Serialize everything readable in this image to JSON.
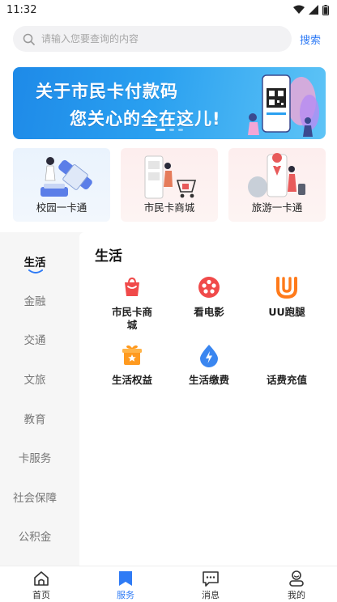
{
  "status_bar": {
    "time": "11:32",
    "icons": [
      "wifi-icon",
      "signal-icon",
      "battery-icon"
    ]
  },
  "search": {
    "placeholder": "请输入您要查询的内容",
    "button_label": "搜索"
  },
  "banner": {
    "line1": "关于市民卡付款码",
    "line2": "您关心的全在这儿!",
    "slide_count": 3,
    "active_slide": 1
  },
  "quick_cards": [
    {
      "label": "校园一卡通",
      "icon": "campus-card-illustration"
    },
    {
      "label": "市民卡商城",
      "icon": "shopping-cart-illustration"
    },
    {
      "label": "旅游一卡通",
      "icon": "travel-map-illustration"
    }
  ],
  "sidebar": {
    "active_index": 0,
    "items": [
      "生活",
      "金融",
      "交通",
      "文旅",
      "教育",
      "卡服务",
      "社会保障",
      "公积金"
    ]
  },
  "content": {
    "title": "生活",
    "services": [
      {
        "label": "市民卡商城",
        "icon": "shopping-bag-icon",
        "color": "#f04a4a"
      },
      {
        "label": "看电影",
        "icon": "film-reel-icon",
        "color": "#f04a4a"
      },
      {
        "label": "UU跑腿",
        "icon": "uu-logo-icon",
        "color": "#ff7a1a"
      },
      {
        "label": "生活权益",
        "icon": "gift-box-icon",
        "color": "#ff9a1f"
      },
      {
        "label": "生活缴费",
        "icon": "water-drop-icon",
        "color": "#3a86f0"
      },
      {
        "label": "话费充值",
        "icon": "",
        "color": ""
      }
    ]
  },
  "tabbar": {
    "active_index": 1,
    "tabs": [
      {
        "label": "首页",
        "icon": "home-icon"
      },
      {
        "label": "服务",
        "icon": "bookmark-icon"
      },
      {
        "label": "消息",
        "icon": "message-icon"
      },
      {
        "label": "我的",
        "icon": "profile-icon"
      }
    ]
  },
  "colors": {
    "accent": "#2f7bf5",
    "banner_blue": "#1e8ae8",
    "red": "#f04a4a",
    "orange": "#ff7a1a"
  }
}
